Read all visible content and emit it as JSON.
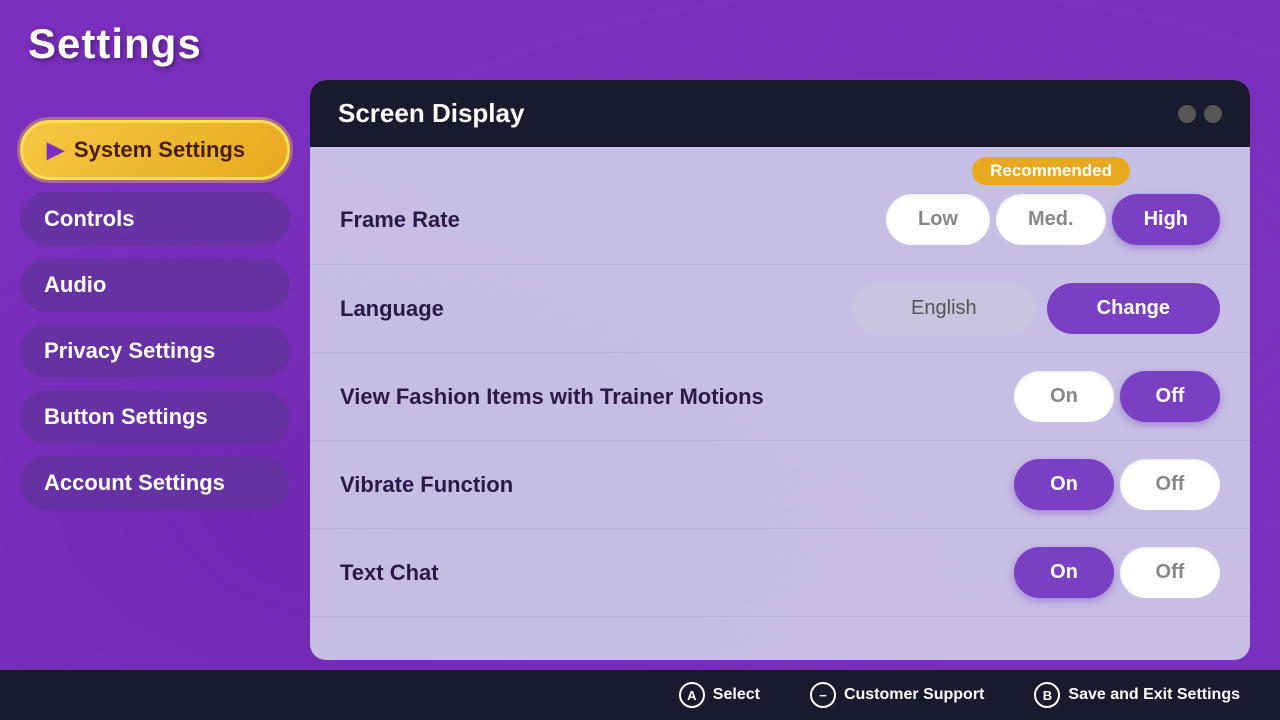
{
  "page": {
    "title": "Settings"
  },
  "sidebar": {
    "items": [
      {
        "id": "system-settings",
        "label": "System Settings",
        "active": true
      },
      {
        "id": "controls",
        "label": "Controls",
        "active": false
      },
      {
        "id": "audio",
        "label": "Audio",
        "active": false
      },
      {
        "id": "privacy-settings",
        "label": "Privacy Settings",
        "active": false
      },
      {
        "id": "button-settings",
        "label": "Button Settings",
        "active": false
      },
      {
        "id": "account-settings",
        "label": "Account Settings",
        "active": false
      }
    ]
  },
  "panel": {
    "title": "Screen Display",
    "recommended_label": "Recommended",
    "settings": [
      {
        "id": "frame-rate",
        "label": "Frame Rate",
        "type": "three-toggle",
        "options": [
          "Low",
          "Med.",
          "High"
        ],
        "selected": "High"
      },
      {
        "id": "language",
        "label": "Language",
        "type": "language",
        "current_value": "English",
        "change_label": "Change"
      },
      {
        "id": "fashion-items",
        "label": "View Fashion Items with Trainer Motions",
        "type": "on-off",
        "selected": "Off"
      },
      {
        "id": "vibrate-function",
        "label": "Vibrate Function",
        "type": "on-off",
        "selected": "On"
      },
      {
        "id": "text-chat",
        "label": "Text Chat",
        "type": "on-off",
        "selected": "On"
      }
    ]
  },
  "bottom_bar": {
    "buttons": [
      {
        "id": "select",
        "icon": "A",
        "label": "Select"
      },
      {
        "id": "customer-support",
        "icon": "−",
        "label": "Customer Support"
      },
      {
        "id": "save-exit",
        "icon": "B",
        "label": "Save and Exit Settings"
      }
    ]
  }
}
